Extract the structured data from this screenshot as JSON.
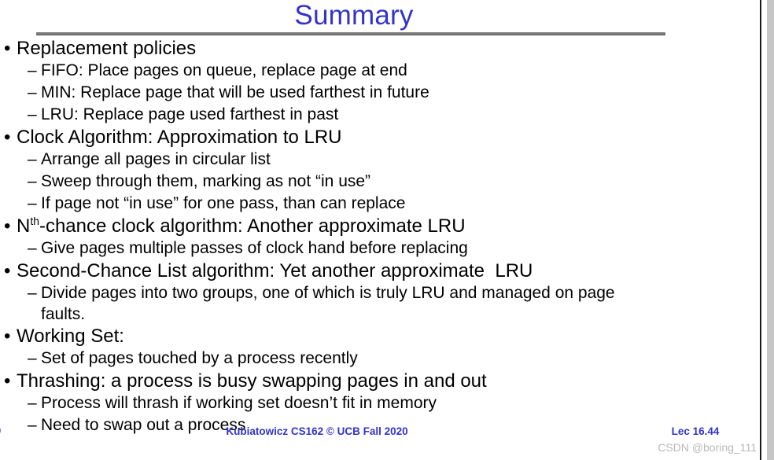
{
  "slide": {
    "title": "Summary",
    "title_color": "#3333CC",
    "rule_color": "#7F7F7F",
    "background": "#FFFFFF",
    "text_color": "#000000"
  },
  "bullets": [
    {
      "level": 1,
      "marker": "•",
      "text": "Replacement policies"
    },
    {
      "level": 2,
      "marker": "–",
      "text": "FIFO: Place pages on queue, replace page at end"
    },
    {
      "level": 2,
      "marker": "–",
      "text": "MIN: Replace page that will be used farthest in future"
    },
    {
      "level": 2,
      "marker": "–",
      "text": "LRU: Replace page used farthest in past"
    },
    {
      "level": 1,
      "marker": "•",
      "text": "Clock Algorithm: Approximation to LRU"
    },
    {
      "level": 2,
      "marker": "–",
      "text": "Arrange all pages in circular list"
    },
    {
      "level": 2,
      "marker": "–",
      "text": "Sweep through them, marking as not “in use”"
    },
    {
      "level": 2,
      "marker": "–",
      "text": "If page not “in use” for one pass, than can replace"
    },
    {
      "level": 1,
      "marker": "•",
      "text_pre": "N",
      "text_sup": "th",
      "text_post": "-chance clock algorithm: Another approximate LRU"
    },
    {
      "level": 2,
      "marker": "–",
      "text": "Give pages multiple passes of clock hand before replacing"
    },
    {
      "level": 1,
      "marker": "•",
      "text": "Second-Chance List algorithm: Yet another approximate  LRU"
    },
    {
      "level": 2,
      "marker": "–",
      "text": "Divide pages into two groups, one of which is truly LRU and managed on page",
      "continuation": "faults."
    },
    {
      "level": 1,
      "marker": "•",
      "text": "Working Set:"
    },
    {
      "level": 2,
      "marker": "–",
      "text": "Set of pages touched by a process recently"
    },
    {
      "level": 1,
      "marker": "•",
      "text": "Thrashing: a process is busy swapping pages in and out"
    },
    {
      "level": 2,
      "marker": "–",
      "text": "Process will thrash if working set doesn’t fit in memory"
    },
    {
      "level": 2,
      "marker": "–",
      "text": "Need to swap out a process"
    }
  ],
  "footer": {
    "left_cut": "0",
    "center": "Kubiatowicz CS162 © UCB Fall 2020",
    "right": "Lec 16.44",
    "footer_color": "#3333CC"
  },
  "watermark": {
    "text": "CSDN @boring_111",
    "color": "#B9B9B9"
  }
}
